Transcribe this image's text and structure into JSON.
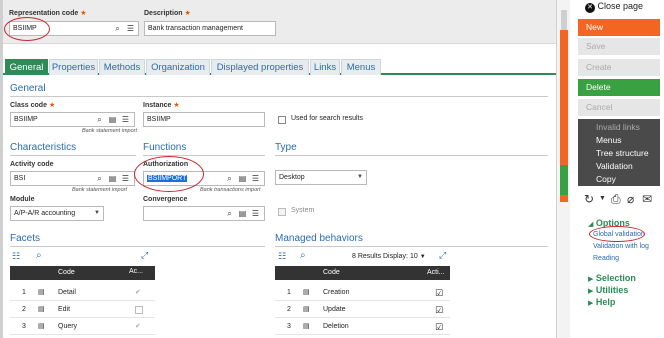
{
  "header": {
    "rep_code_label": "Representation code",
    "rep_code_value": "BSIIMP",
    "description_label": "Description",
    "description_value": "Bank transaction management"
  },
  "tabs": [
    "General",
    "Properties",
    "Methods",
    "Organization",
    "Displayed properties",
    "Links",
    "Menus"
  ],
  "general": {
    "title": "General",
    "class_code_label": "Class code",
    "class_code_value": "BSIIMP",
    "class_code_hint": "Bank statement import",
    "instance_label": "Instance",
    "instance_value": "BSIIMP",
    "search_label": "Used for search results"
  },
  "characteristics": {
    "title": "Characteristics",
    "activity_label": "Activity code",
    "activity_value": "BSI",
    "activity_hint": "Bank statement import",
    "module_label": "Module",
    "module_value": "A/P-A/R accounting"
  },
  "functions": {
    "title": "Functions",
    "authorization_label": "Authorization",
    "authorization_value": "BSIIMPORT",
    "authorization_hint": "Bank transactions import",
    "convergence_label": "Convergence"
  },
  "type": {
    "title": "Type",
    "value": "Desktop",
    "system_label": "System"
  },
  "facets": {
    "title": "Facets",
    "col_code": "Code",
    "col_ac": "Ac...",
    "rows": [
      {
        "num": "1",
        "code": "Detail"
      },
      {
        "num": "2",
        "code": "Edit"
      },
      {
        "num": "3",
        "code": "Query"
      }
    ]
  },
  "behaviors": {
    "title": "Managed behaviors",
    "results": "8 Results",
    "display_label": "Display:",
    "display_value": "10",
    "col_code": "Code",
    "col_act": "Acti...",
    "rows": [
      {
        "num": "1",
        "code": "Creation"
      },
      {
        "num": "2",
        "code": "Update"
      },
      {
        "num": "3",
        "code": "Deletion"
      }
    ]
  },
  "panel": {
    "close": "Close page",
    "new": "New",
    "save": "Save",
    "create": "Create",
    "delete": "Delete",
    "cancel": "Cancel",
    "menu_items": [
      "Invalid links",
      "Menus",
      "Tree structure",
      "Validation",
      "Copy"
    ],
    "options_title": "Options",
    "options": [
      "Global validation",
      "Validation with log",
      "Reading"
    ],
    "sections": [
      "Selection",
      "Utilities",
      "Help"
    ]
  },
  "colors": {
    "accent_green": "#2e8b57",
    "new_orange": "#f26522",
    "delete_green": "#3aa143",
    "link_blue": "#2b6cae",
    "annotation_red": "#c8262c"
  }
}
